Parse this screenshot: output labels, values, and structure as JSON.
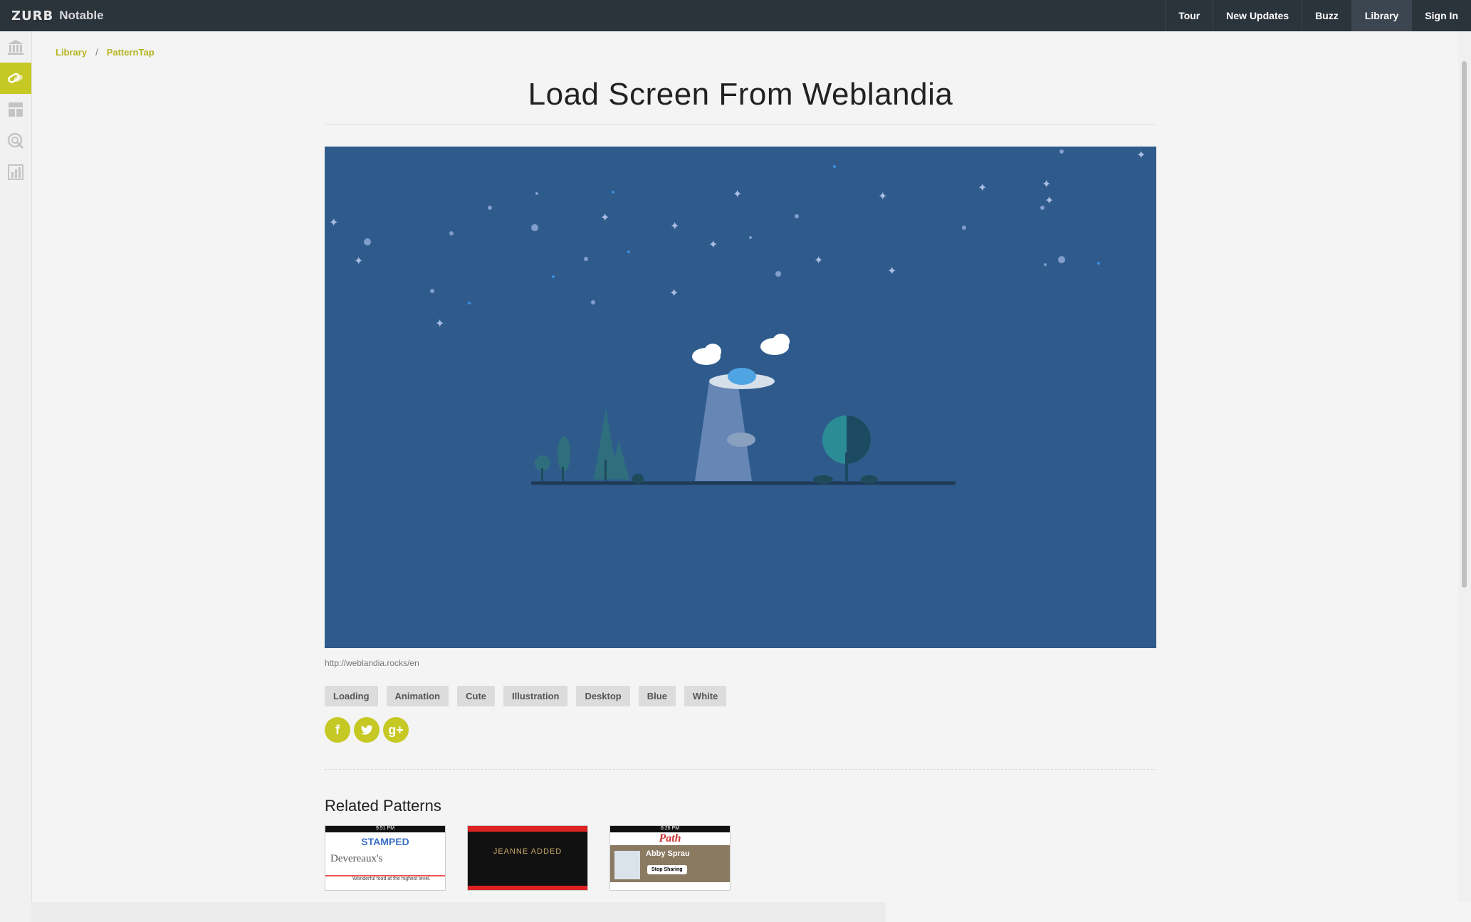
{
  "app": {
    "brand": "ZURB",
    "name": "Notable"
  },
  "nav": {
    "items": [
      {
        "label": "Tour"
      },
      {
        "label": "New Updates"
      },
      {
        "label": "Buzz"
      },
      {
        "label": "Library"
      },
      {
        "label": "Sign In"
      }
    ],
    "active": "Library"
  },
  "sidebar": {
    "items": [
      {
        "icon": "library-icon"
      },
      {
        "icon": "pills-icon"
      },
      {
        "icon": "layout-icon"
      },
      {
        "icon": "spotlight-icon"
      },
      {
        "icon": "chart-icon"
      }
    ],
    "active_index": 1
  },
  "breadcrumb": {
    "root": "Library",
    "separator": "/",
    "current": "PatternTap"
  },
  "pattern": {
    "title": "Load Screen From Weblandia",
    "source_url": "http://weblandia.rocks/en",
    "tags": [
      "Loading",
      "Animation",
      "Cute",
      "Illustration",
      "Desktop",
      "Blue",
      "White"
    ]
  },
  "social": {
    "facebook": "f",
    "twitter": "t",
    "google": "g+"
  },
  "related": {
    "title": "Related Patterns",
    "items": [
      {
        "app": "STAMPED",
        "name": "Devereaux's",
        "tagline": "Wonderful food at the highest level.",
        "time": "9:51 PM"
      },
      {
        "app": "",
        "name": "JEANNE ADDED",
        "tagline": "",
        "time": ""
      },
      {
        "app": "Path",
        "name": "Abby Sprau",
        "tagline": "Stop Sharing",
        "time": "6:26 PM"
      }
    ]
  },
  "colors": {
    "accent": "#c6c824",
    "topbar": "#2b333b",
    "hero_bg": "#2e5b8c"
  }
}
